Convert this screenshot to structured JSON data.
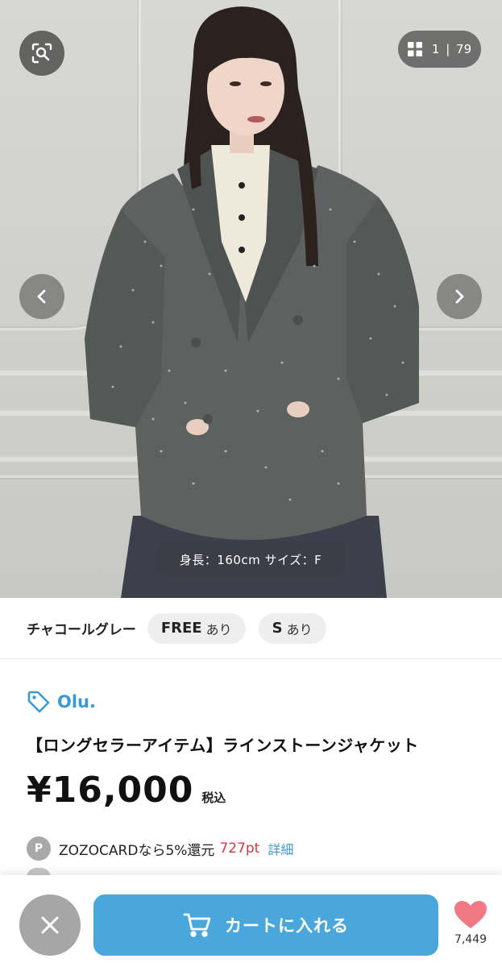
{
  "gallery": {
    "counter_current": "1",
    "counter_separator": "|",
    "counter_total": "79",
    "caption": "身長：160cm サイズ：F",
    "icons": {
      "zoom": "search-in-frame-icon",
      "grid": "grid-icon",
      "prev": "chevron-left-icon",
      "next": "chevron-right-icon"
    }
  },
  "variants": {
    "color_name": "チャコールグレー",
    "sizes": [
      {
        "size": "FREE",
        "stock": "あり"
      },
      {
        "size": "S",
        "stock": "あり"
      }
    ]
  },
  "product": {
    "brand": "Olu.",
    "brand_icon": "tag-icon",
    "title": "【ロングセラーアイテム】ラインストーンジャケット",
    "price": "¥16,000",
    "tax_label": "税込",
    "points": {
      "badge": "P",
      "text": "ZOZOCARDなら5%還元",
      "amount": "727pt",
      "detail_link": "詳細"
    }
  },
  "bottom_bar": {
    "cart_label": "カートに入れる",
    "favorite_count": "7,449",
    "colors": {
      "cart": "#4aa7dc",
      "heart": "#f07a84",
      "close": "#a6a6a6"
    }
  }
}
